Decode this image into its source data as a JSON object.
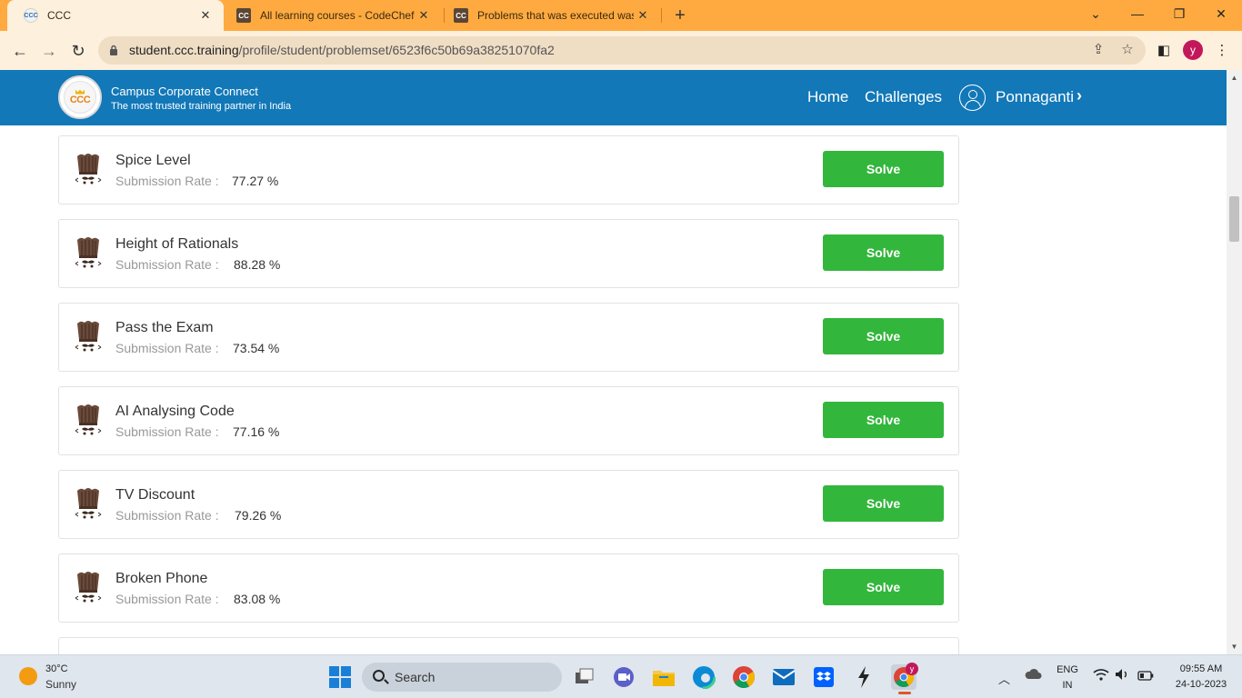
{
  "browser": {
    "tabs": [
      {
        "favicon": "CCC",
        "title": "CCC",
        "active": true
      },
      {
        "favicon": "CC",
        "title": "All learning courses - CodeChef",
        "active": false
      },
      {
        "favicon": "CC",
        "title": "Problems that was executed was",
        "active": false
      }
    ],
    "close_glyph": "✕",
    "new_tab_glyph": "+",
    "url_host": "student.ccc.training",
    "url_path": "/profile/student/problemset/6523f6c50b69a38251070fa2",
    "profile_initial": "y"
  },
  "site": {
    "logo_text": "CCC",
    "brand_name": "Campus Corporate Connect",
    "tagline": "The most trusted training partner in India",
    "nav": {
      "home": "Home",
      "challenges": "Challenges"
    },
    "user_name": "Ponnaganti",
    "user_chevron": "›"
  },
  "problems": {
    "rate_label": "Submission Rate :",
    "solve_label": "Solve",
    "items": [
      {
        "name": "Spice Level",
        "rate": "77.27 %"
      },
      {
        "name": "Height of Rationals",
        "rate": "88.28 %"
      },
      {
        "name": "Pass the Exam",
        "rate": "73.54 %"
      },
      {
        "name": "AI Analysing Code",
        "rate": "77.16 %"
      },
      {
        "name": "TV Discount",
        "rate": "79.26 %"
      },
      {
        "name": "Broken Phone",
        "rate": "83.08 %"
      }
    ]
  },
  "taskbar": {
    "temperature": "30°C",
    "condition": "Sunny",
    "search_placeholder": "Search",
    "language": "ENG",
    "region": "IN",
    "time": "09:55 AM",
    "date": "24-10-2023",
    "chrome_badge": "y"
  },
  "colors": {
    "tab_strip": "#ffaa40",
    "toolbar": "#fdf0dc",
    "header": "#1278b8",
    "solve_button": "#33b63c"
  }
}
